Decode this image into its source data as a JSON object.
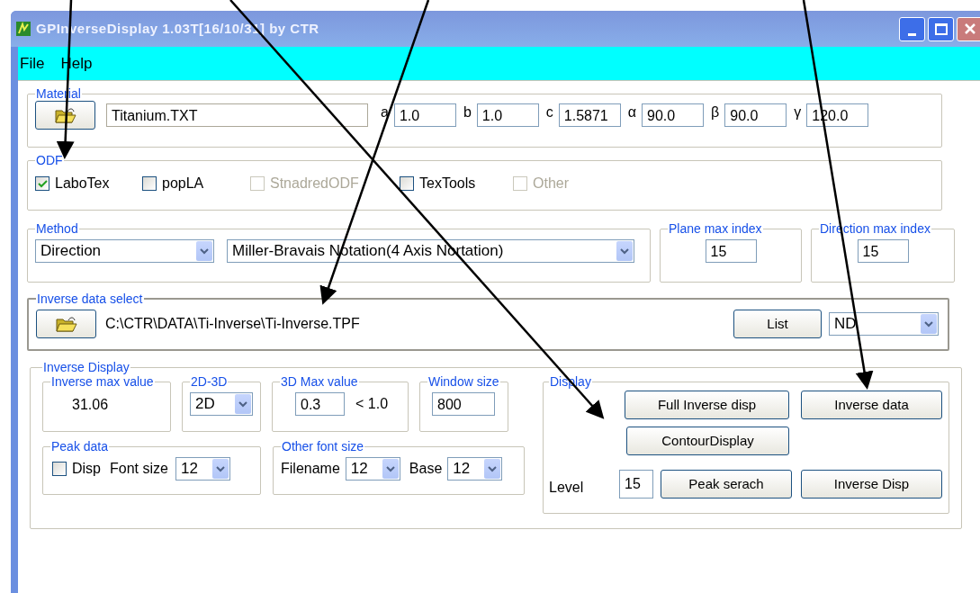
{
  "window": {
    "title": "GPInverseDisplay 1.03T[16/10/31] by CTR",
    "menu": [
      "File",
      "Help"
    ]
  },
  "material": {
    "label": "Material",
    "filename": "Titanium.TXT",
    "params": [
      {
        "label": "a",
        "value": "1.0"
      },
      {
        "label": "b",
        "value": "1.0"
      },
      {
        "label": "c",
        "value": "1.5871"
      },
      {
        "label": "α",
        "value": "90.0"
      },
      {
        "label": "β",
        "value": "90.0"
      },
      {
        "label": "γ",
        "value": "120.0"
      }
    ]
  },
  "odf": {
    "label": "ODF",
    "options": [
      {
        "label": "LaboTex",
        "checked": true,
        "disabled": false
      },
      {
        "label": "popLA",
        "checked": false,
        "disabled": false
      },
      {
        "label": "StnadredODF",
        "checked": false,
        "disabled": true
      },
      {
        "label": "TexTools",
        "checked": false,
        "disabled": false
      },
      {
        "label": "Other",
        "checked": false,
        "disabled": true
      }
    ]
  },
  "method": {
    "label": "Method",
    "type": "Direction",
    "notation": "Miller-Bravais Notation(4 Axis Nortation)"
  },
  "plane_max_index": {
    "label": "Plane max index",
    "value": "15"
  },
  "direction_max_index": {
    "label": "Direction max index",
    "value": "15"
  },
  "inverse_data_select": {
    "label": "Inverse data select",
    "path": "C:\\CTR\\DATA\\Ti-Inverse\\Ti-Inverse.TPF",
    "list_button": "List",
    "axis": "ND"
  },
  "inverse_display": {
    "label": "Inverse Display",
    "max_value": {
      "label": "Inverse max value",
      "value": "31.06"
    },
    "dimension": {
      "label": "2D-3D",
      "value": "2D"
    },
    "max_3d": {
      "label": "3D Max value",
      "value": "0.3",
      "limit": "< 1.0"
    },
    "window_size": {
      "label": "Window size",
      "value": "800"
    },
    "peak_data": {
      "label": "Peak data",
      "disp": {
        "label": "Disp",
        "checked": false
      },
      "font_size_label": "Font size",
      "font_size": "12"
    },
    "other_font_size": {
      "label": "Other font size",
      "filename_label": "Filename",
      "filename_size": "12",
      "base_label": "Base",
      "base_size": "12"
    },
    "display": {
      "label": "Display",
      "buttons": [
        "Full Inverse disp",
        "Inverse data",
        "ContourDisplay",
        "Peak serach",
        "Inverse Disp"
      ],
      "level_label": "Level",
      "level": "15"
    }
  }
}
